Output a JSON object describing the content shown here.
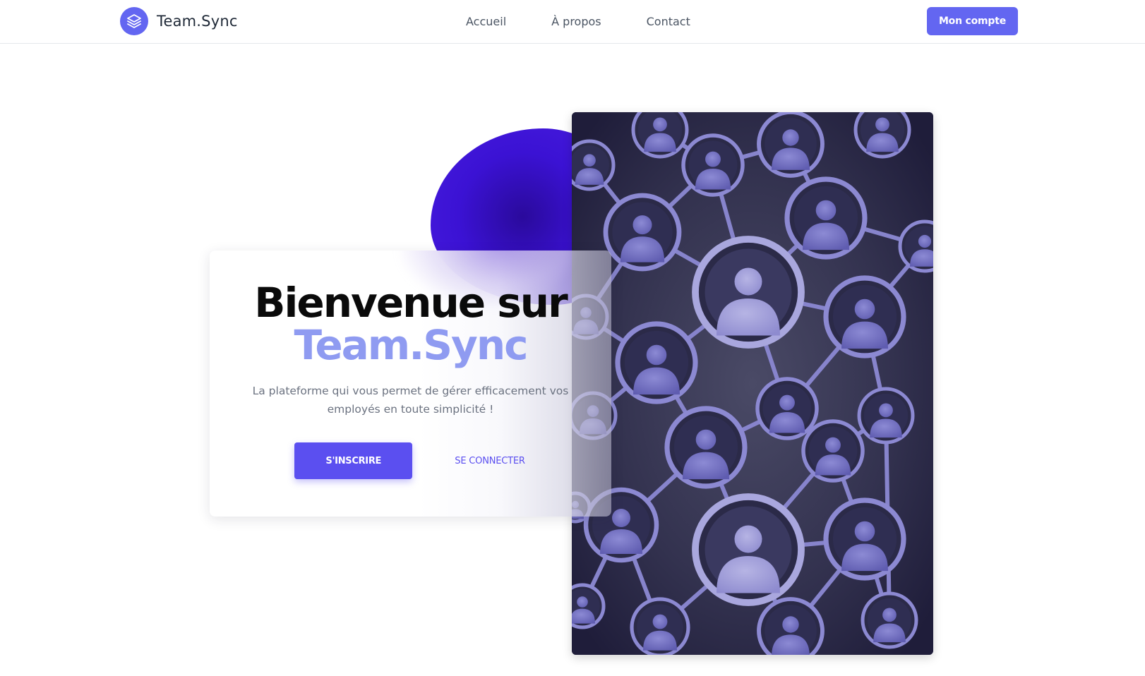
{
  "header": {
    "brand_name": "Team.Sync",
    "nav": [
      {
        "label": "Accueil"
      },
      {
        "label": "À propos"
      },
      {
        "label": "Contact"
      }
    ],
    "account_button": "Mon compte"
  },
  "hero": {
    "title_line1": "Bienvenue sur",
    "title_line2": "Team.Sync",
    "subtitle": "La plateforme qui vous permet de gérer efficacement vos employés en toute simplicité !",
    "signup_button": "S'INSCRIRE",
    "login_button": "SE CONNECTER"
  },
  "colors": {
    "accent": "#6366f1",
    "title_accent": "#8f9bf1",
    "button": "#5b4ff0",
    "blob": "#3b12d4"
  },
  "icons": {
    "brand": "layers-icon",
    "photo": "network-people-image"
  }
}
